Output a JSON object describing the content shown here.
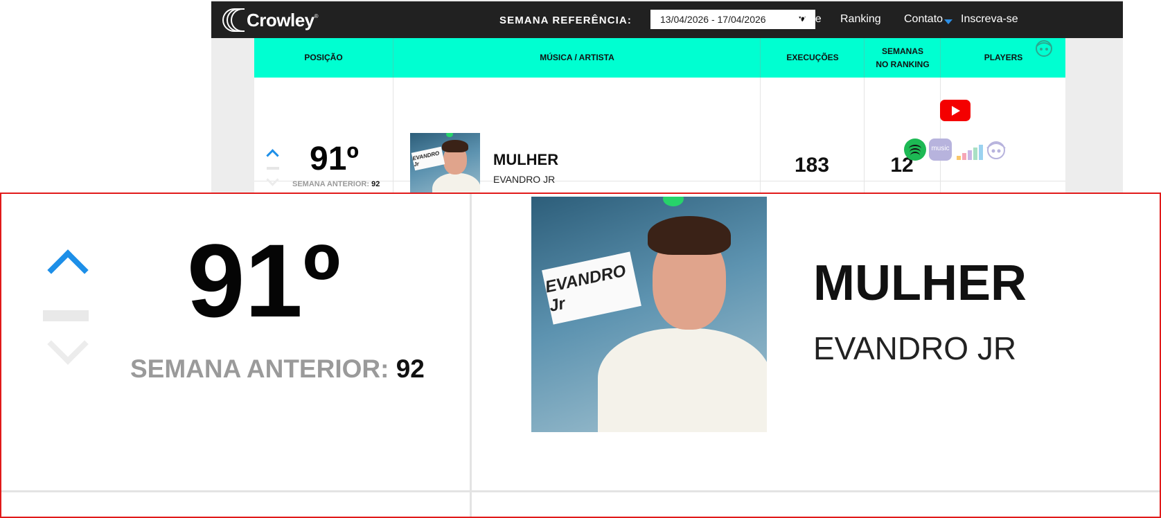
{
  "header": {
    "logo_text": "Crowley",
    "logo_reg": "®",
    "week_label": "SEMANA REFERÊNCIA:",
    "week_value": "13/04/2026 - 17/04/2026",
    "nav": [
      "Home",
      "Ranking",
      "Contato",
      "Inscreva-se"
    ]
  },
  "table": {
    "headers": {
      "position": "POSIÇÃO",
      "song": "MÚSICA / ARTISTA",
      "plays": "EXECUÇÕES",
      "weeks_line1": "SEMANAS",
      "weeks_line2": "NO RANKING",
      "players": "PLAYERS"
    },
    "row": {
      "position": "91º",
      "trend": "up",
      "prev_label": "SEMANA ANTERIOR:",
      "prev_value": "92",
      "title": "MULHER",
      "artist": "EVANDRO JR",
      "plays": "183",
      "weeks": "12",
      "cover_text": "EVANDRO Jr",
      "players": [
        "youtube-icon",
        "spotify-icon",
        "amazon-music-icon",
        "deezer-icon",
        "napster-icon"
      ],
      "amazon_label": "music"
    }
  },
  "colors": {
    "accent_header": "#00ffd1",
    "navbar": "#212121",
    "trend_up": "#1d8fe8",
    "youtube": "#f40000",
    "spotify": "#1db954",
    "highlight_frame": "#e11a1a"
  }
}
